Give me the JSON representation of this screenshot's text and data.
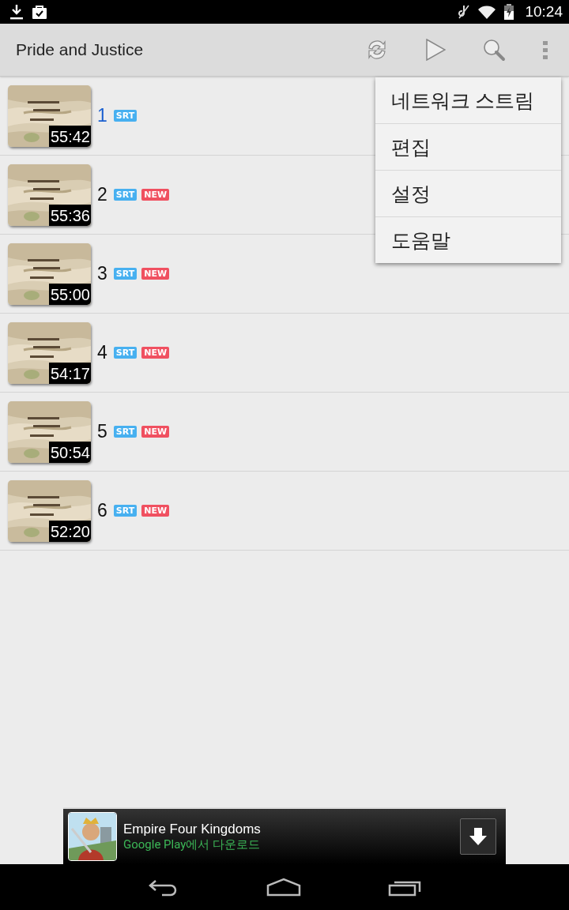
{
  "status_bar": {
    "time": "10:24"
  },
  "action_bar": {
    "title": "Pride and Justice"
  },
  "episodes": [
    {
      "number": "1",
      "selected": true,
      "duration": "55:42",
      "badges": [
        {
          "label": "SRT",
          "kind": "srt"
        }
      ]
    },
    {
      "number": "2",
      "selected": false,
      "duration": "55:36",
      "badges": [
        {
          "label": "SRT",
          "kind": "srt"
        },
        {
          "label": "NEW",
          "kind": "new"
        }
      ]
    },
    {
      "number": "3",
      "selected": false,
      "duration": "55:00",
      "badges": [
        {
          "label": "SRT",
          "kind": "srt"
        },
        {
          "label": "NEW",
          "kind": "new"
        }
      ]
    },
    {
      "number": "4",
      "selected": false,
      "duration": "54:17",
      "badges": [
        {
          "label": "SRT",
          "kind": "srt"
        },
        {
          "label": "NEW",
          "kind": "new"
        }
      ]
    },
    {
      "number": "5",
      "selected": false,
      "duration": "50:54",
      "badges": [
        {
          "label": "SRT",
          "kind": "srt"
        },
        {
          "label": "NEW",
          "kind": "new"
        }
      ]
    },
    {
      "number": "6",
      "selected": false,
      "duration": "52:20",
      "badges": [
        {
          "label": "SRT",
          "kind": "srt"
        },
        {
          "label": "NEW",
          "kind": "new"
        }
      ]
    }
  ],
  "overflow_menu": {
    "items": [
      "네트워크 스트림",
      "편집",
      "설정",
      "도움말"
    ]
  },
  "ad_banner": {
    "title": "Empire Four Kingdoms",
    "subtitle": "Google Play에서 다운로드"
  }
}
